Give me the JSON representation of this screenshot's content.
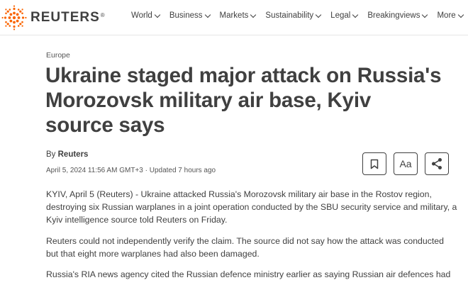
{
  "brand": {
    "name": "REUTERS",
    "registered": "®"
  },
  "nav": {
    "items": [
      {
        "label": "World"
      },
      {
        "label": "Business"
      },
      {
        "label": "Markets"
      },
      {
        "label": "Sustainability"
      },
      {
        "label": "Legal"
      },
      {
        "label": "Breakingviews"
      },
      {
        "label": "More"
      }
    ]
  },
  "article": {
    "category": "Europe",
    "headline": "Ukraine staged major attack on Russia's Morozovsk military air base, Kyiv source says",
    "byline_prefix": "By ",
    "author": "Reuters",
    "date": "April 5, 2024 11:56 AM GMT+3 · Updated 7 hours ago",
    "paragraphs": [
      "KYIV, April 5 (Reuters) - Ukraine attacked Russia's Morozovsk military air base in the Rostov region, destroying six Russian warplanes in a joint operation conducted by the SBU security service and military, a Kyiv intelligence source told Reuters on Friday.",
      "Reuters could not independently verify the claim. The source did not say how the attack was conducted but that eight more warplanes had also been damaged.",
      "Russia's RIA news agency cited the Russian defence ministry earlier as saying Russian air defences had"
    ]
  },
  "tools": {
    "bookmark_icon": "bookmark-icon",
    "text_size_label": "Aa",
    "share_icon": "share-icon"
  },
  "colors": {
    "text": "#404040",
    "logo_orange": "#fa6400",
    "border": "#e6e6e6"
  }
}
